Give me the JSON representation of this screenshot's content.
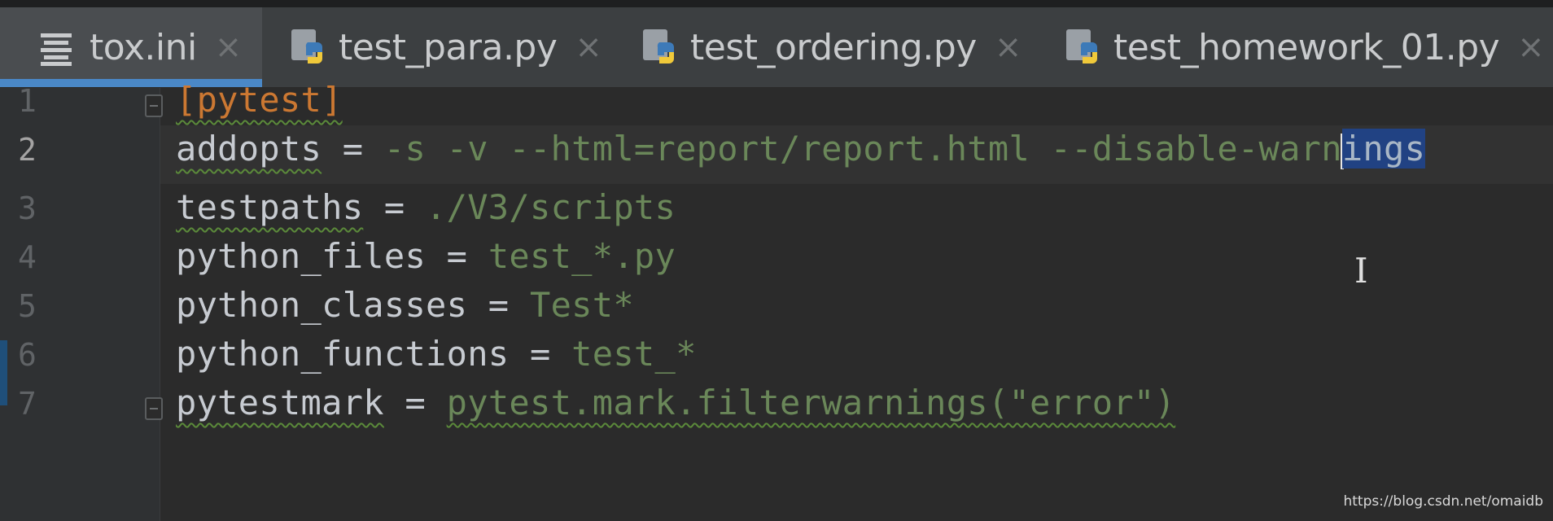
{
  "tabs": [
    {
      "label": "tox.ini",
      "icon": "ini-file-icon",
      "active": true
    },
    {
      "label": "test_para.py",
      "icon": "python-file-icon",
      "active": false
    },
    {
      "label": "test_ordering.py",
      "icon": "python-file-icon",
      "active": false
    },
    {
      "label": "test_homework_01.py",
      "icon": "python-file-icon",
      "active": false
    }
  ],
  "close_glyph": "×",
  "editor": {
    "lines": [
      {
        "no": "1",
        "section": "[pytest]"
      },
      {
        "no": "2",
        "key": "addopts",
        "eq": " = ",
        "value_before_sel": "-s -v --html=report/report.html --disable-warn",
        "value_selected": "ings"
      },
      {
        "no": "3",
        "key": "testpaths",
        "eq": " = ",
        "value": "./V3/scripts"
      },
      {
        "no": "4",
        "key": "python_files",
        "eq": " = ",
        "value": "test_*.py"
      },
      {
        "no": "5",
        "key": "python_classes",
        "eq": " = ",
        "value": "Test*"
      },
      {
        "no": "6",
        "key": "python_functions",
        "eq": " = ",
        "value": "test_*"
      },
      {
        "no": "7",
        "key": "pytestmark",
        "eq": " = ",
        "value": "pytest.mark.filterwarnings(\"error\")"
      }
    ],
    "current_line": "2",
    "mouse_cursor": "I"
  },
  "watermark": "https://blog.csdn.net/omaidb",
  "colors": {
    "accent": "#4a88c7",
    "section": "#cc7832",
    "string_value": "#6a8759",
    "selection": "#214283",
    "background": "#2b2b2b"
  }
}
